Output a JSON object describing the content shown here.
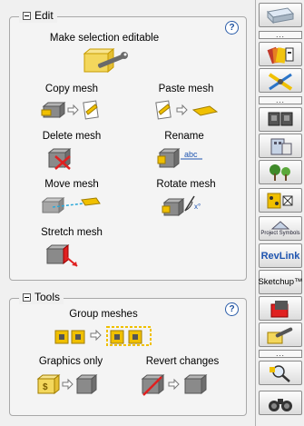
{
  "edit": {
    "title": "Edit",
    "help": "?",
    "make_editable": "Make selection editable",
    "copy_mesh": "Copy mesh",
    "paste_mesh": "Paste mesh",
    "delete_mesh": "Delete mesh",
    "rename": "Rename",
    "rename_tag": "abc",
    "move_mesh": "Move mesh",
    "rotate_mesh": "Rotate mesh",
    "rotate_tag": "x°",
    "stretch_mesh": "Stretch mesh"
  },
  "tools": {
    "title": "Tools",
    "help": "?",
    "group_meshes": "Group meshes",
    "graphics_only": "Graphics only",
    "revert_changes": "Revert changes"
  },
  "sidebar": {
    "dots": "...",
    "revlink": "RevLink",
    "sketchup": "Sketchup™",
    "project_symbols": "Project Symbols"
  },
  "colors": {
    "accent": "#f0c000",
    "box": "#8a8a8a",
    "delete": "#e02020",
    "link": "#1f55b0"
  }
}
